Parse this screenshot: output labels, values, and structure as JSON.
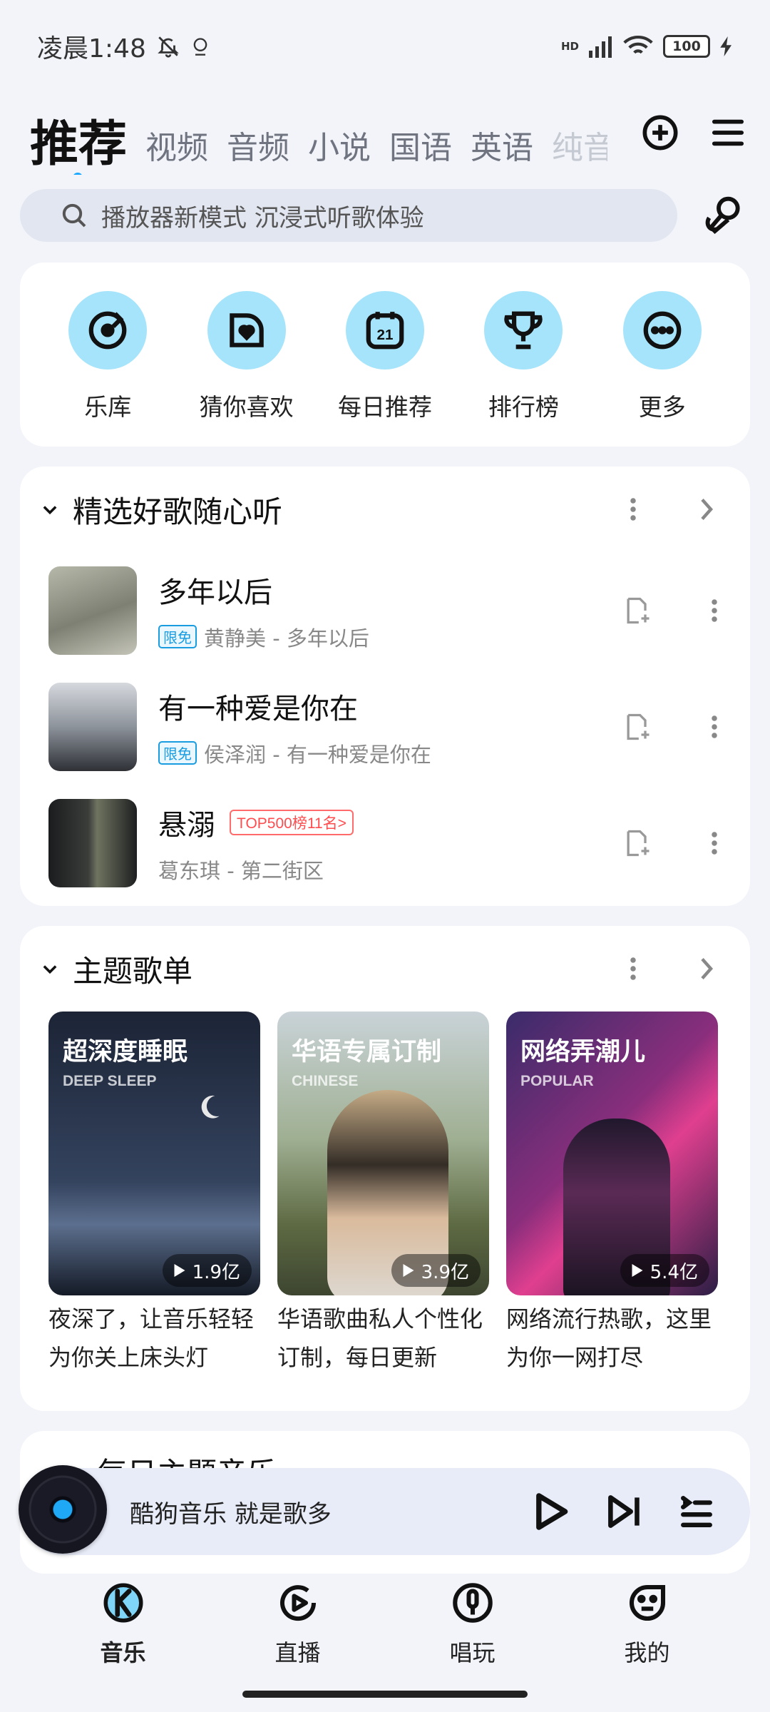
{
  "status_bar": {
    "time": "凌晨1:48",
    "signal_label": "HD",
    "battery": "100"
  },
  "top_tabs": [
    "推荐",
    "视频",
    "音频",
    "小说",
    "国语",
    "英语",
    "纯音"
  ],
  "search": {
    "placeholder": "播放器新模式 沉浸式听歌体验"
  },
  "quick_entries": [
    {
      "label": "乐库",
      "icon": "vinyl-icon"
    },
    {
      "label": "猜你喜欢",
      "icon": "heart-box-icon"
    },
    {
      "label": "每日推荐",
      "icon": "calendar-icon",
      "day": "21"
    },
    {
      "label": "排行榜",
      "icon": "trophy-icon"
    },
    {
      "label": "更多",
      "icon": "more-icon"
    }
  ],
  "song_section": {
    "title": "精选好歌随心听",
    "songs": [
      {
        "name": "多年以后",
        "tag": "限免",
        "meta": "黄静美 - 多年以后",
        "badge": ""
      },
      {
        "name": "有一种爱是你在",
        "tag": "限免",
        "meta": "侯泽润 - 有一种爱是你在",
        "badge": ""
      },
      {
        "name": "悬溺",
        "tag": "",
        "meta": "葛东琪 - 第二街区",
        "badge": "TOP500榜11名>"
      }
    ]
  },
  "playlist_section": {
    "title": "主题歌单",
    "items": [
      {
        "title": "超深度睡眠",
        "subtitle_en": "DEEP SLEEP",
        "plays": "1.9亿",
        "desc": "夜深了，让音乐轻轻为你关上床头灯"
      },
      {
        "title": "华语专属订制",
        "subtitle_en": "CHINESE",
        "plays": "3.9亿",
        "desc": "华语歌曲私人个性化订制，每日更新"
      },
      {
        "title": "网络弄潮儿",
        "subtitle_en": "POPULAR",
        "plays": "5.4亿",
        "desc": "网络流行热歌，这里为你一网打尽"
      }
    ]
  },
  "next_section": {
    "title": "每日主题音乐"
  },
  "mini_player": {
    "text": "酷狗音乐 就是歌多"
  },
  "bottom_nav": [
    {
      "label": "音乐",
      "icon": "kugou-music-icon",
      "active": true
    },
    {
      "label": "直播",
      "icon": "live-icon",
      "active": false
    },
    {
      "label": "唱玩",
      "icon": "mic-play-icon",
      "active": false
    },
    {
      "label": "我的",
      "icon": "profile-face-icon",
      "active": false
    }
  ],
  "colors": {
    "accent": "#1aa7ff",
    "icon_bg": "#a6e4fb",
    "badge_red": "#ff4d4f",
    "page_bg": "#f2f4f9"
  }
}
